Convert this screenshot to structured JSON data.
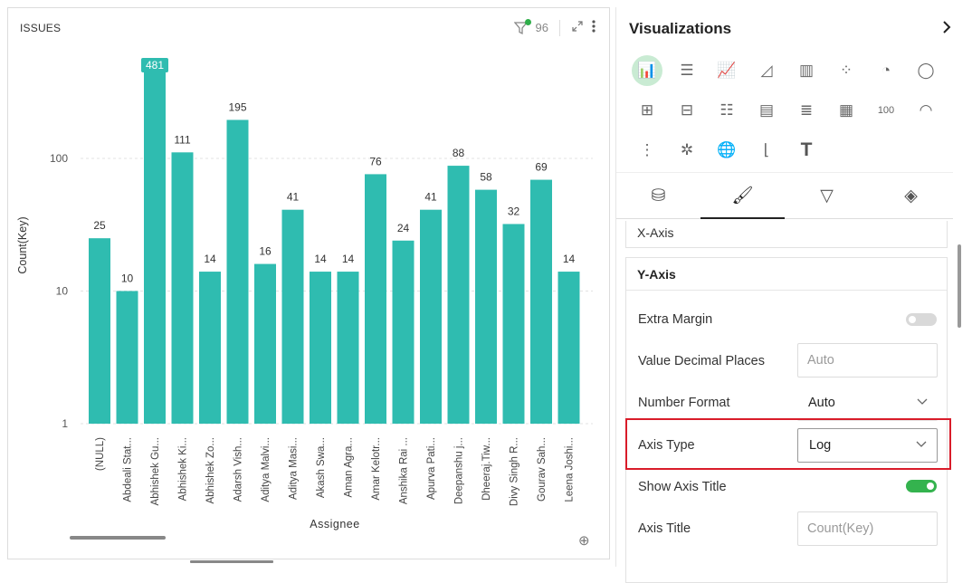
{
  "chart_panel": {
    "title": "ISSUES",
    "filter_count": "96",
    "expand_icon": "expand-icon",
    "more_icon": "more-vertical-icon"
  },
  "chart_data": {
    "type": "bar",
    "ylabel": "Count(Key)",
    "xlabel": "Assignee",
    "yscale": "log",
    "ylim": [
      1,
      481
    ],
    "yticks": [
      "1",
      "10",
      "100"
    ],
    "color": "#2fbcb0",
    "categories": [
      "(NULL)",
      "Abdeali Stat...",
      "Abhishek Gu...",
      "Abhishek Ki...",
      "Abhishek Zo...",
      "Adarsh Vish...",
      "Aditya Malvi...",
      "Aditya Masi...",
      "Akash Swa...",
      "Aman Agra...",
      "Amar Kelotr...",
      "Anshika Rai ...",
      "Apurva Pati...",
      "Deepanshu j...",
      "Dheeraj.Tiw...",
      "Divy Singh R...",
      "Gourav Sah...",
      "Leena Joshi..."
    ],
    "values": [
      25,
      10,
      481,
      111,
      14,
      195,
      16,
      41,
      14,
      14,
      76,
      24,
      41,
      88,
      58,
      32,
      69,
      14
    ],
    "value_labels": [
      "25",
      "10",
      "481",
      "111",
      "14",
      "195",
      "16",
      "41",
      "14",
      "14",
      "76",
      "24",
      "41",
      "88",
      "58",
      "32",
      "69",
      "14"
    ],
    "highlighted_index": 2
  },
  "viz_panel": {
    "title": "Visualizations",
    "collapse_icon": "chevron-right-icon",
    "icons": [
      {
        "name": "bar-chart-icon",
        "glyph": "📊",
        "active": true
      },
      {
        "name": "horizontal-bar-icon",
        "glyph": "☰"
      },
      {
        "name": "line-chart-icon",
        "glyph": "📈"
      },
      {
        "name": "area-chart-icon",
        "glyph": "◿"
      },
      {
        "name": "combo-chart-icon",
        "glyph": "▥"
      },
      {
        "name": "scatter-chart-icon",
        "glyph": "⁘"
      },
      {
        "name": "pie-chart-icon",
        "glyph": "◔"
      },
      {
        "name": "donut-chart-icon",
        "glyph": "◯"
      },
      {
        "name": "pivot-table-icon",
        "glyph": "⊞"
      },
      {
        "name": "detail-table-icon",
        "glyph": "⊟"
      },
      {
        "name": "filter-list-icon",
        "glyph": "☷"
      },
      {
        "name": "table-icon",
        "glyph": "▤"
      },
      {
        "name": "list-icon",
        "glyph": "≣"
      },
      {
        "name": "card-grid-icon",
        "glyph": "▦"
      },
      {
        "name": "kpi-number-icon",
        "glyph": "100",
        "text": true
      },
      {
        "name": "gauge-icon",
        "glyph": "◠"
      },
      {
        "name": "funnel-list-icon",
        "glyph": "⋮"
      },
      {
        "name": "network-icon",
        "glyph": "✲"
      },
      {
        "name": "globe-map-icon",
        "glyph": "🌐"
      },
      {
        "name": "step-chart-icon",
        "glyph": "⌊"
      },
      {
        "name": "text-icon",
        "glyph": "T",
        "t": true
      }
    ],
    "tabs": [
      {
        "name": "tab-data-icon",
        "glyph": "⛁"
      },
      {
        "name": "tab-format-icon",
        "glyph": "🖌",
        "active": true
      },
      {
        "name": "tab-filter-icon",
        "glyph": "▽"
      },
      {
        "name": "tab-theme-icon",
        "glyph": "◈"
      }
    ],
    "x_axis_label": "X-Axis",
    "y_axis": {
      "header": "Y-Axis",
      "extra_margin_label": "Extra Margin",
      "decimal_places_label": "Value Decimal Places",
      "decimal_places_placeholder": "Auto",
      "number_format_label": "Number Format",
      "number_format_value": "Auto",
      "axis_type_label": "Axis Type",
      "axis_type_value": "Log",
      "show_axis_title_label": "Show Axis Title",
      "axis_title_label": "Axis Title",
      "axis_title_placeholder": "Count(Key)"
    }
  }
}
